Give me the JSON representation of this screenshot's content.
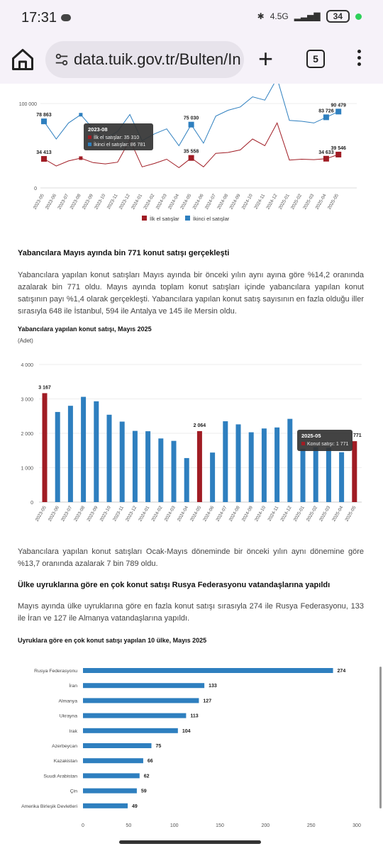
{
  "status_bar": {
    "time": "17:31",
    "network": "4.5G",
    "battery": "34"
  },
  "browser": {
    "url": "data.tuik.gov.tr/Bulten/In",
    "tab_count": "5"
  },
  "chart1": {
    "type": "line",
    "y_ticks": [
      "0",
      "100 000"
    ],
    "x_labels": [
      "2023-05",
      "2023-06",
      "2023-07",
      "2023-08",
      "2023-09",
      "2023-10",
      "2023-11",
      "2023-12",
      "2024-01",
      "2024-02",
      "2024-03",
      "2024-04",
      "2024-05",
      "2024-06",
      "2024-07",
      "2024-08",
      "2024-09",
      "2024-10",
      "2024-11",
      "2024-12",
      "2025-01",
      "2025-02",
      "2025-03",
      "2025-04",
      "2025-05"
    ],
    "series": [
      {
        "name": "İlk el satışlar",
        "color": "#a01c24",
        "values": [
          34413,
          26000,
          32000,
          35310,
          30000,
          28500,
          30500,
          57000,
          25000,
          29000,
          34000,
          24000,
          35558,
          25000,
          41000,
          42000,
          45000,
          58000,
          50000,
          77000,
          33000,
          34000,
          33500,
          34633,
          39546
        ]
      },
      {
        "name": "İkinci el satışlar",
        "color": "#2e7fbf",
        "values": [
          78863,
          58000,
          77000,
          86781,
          70000,
          58000,
          67000,
          87000,
          56000,
          64000,
          70000,
          50000,
          75030,
          53000,
          85000,
          92000,
          96000,
          108000,
          104000,
          130000,
          80000,
          79000,
          77000,
          83726,
          90479
        ]
      }
    ],
    "point_labels": [
      {
        "text": "78 863",
        "i": 0,
        "s": 1
      },
      {
        "text": "34 413",
        "i": 0,
        "s": 0
      },
      {
        "text": "75 030",
        "i": 12,
        "s": 1
      },
      {
        "text": "35 558",
        "i": 12,
        "s": 0
      },
      {
        "text": "83 726",
        "i": 23,
        "s": 1
      },
      {
        "text": "34 633",
        "i": 23,
        "s": 0
      },
      {
        "text": "90 479",
        "i": 24,
        "s": 1
      },
      {
        "text": "39 546",
        "i": 24,
        "s": 0
      }
    ],
    "tooltip": {
      "title": "2023-08",
      "line1": "İlk el satışlar: 35 310",
      "line2": "İkinci el satışlar: 86 781"
    },
    "legend": [
      "İlk el satışlar",
      "İkinci el satışlar"
    ]
  },
  "section1": {
    "heading": "Yabancılara Mayıs ayında bin 771 konut satışı gerçekleşti",
    "paragraph": "Yabancılara yapılan konut satışları Mayıs ayında bir önceki yılın aynı ayına göre %14,2 oranında azalarak bin 771 oldu. Mayıs ayında toplam konut satışları içinde yabancılara yapılan konut satışının payı %1,4 olarak gerçekleşti. Yabancılara yapılan konut satış sayısının en fazla olduğu iller sırasıyla 648 ile İstanbul, 594 ile Antalya ve 145 ile Mersin oldu."
  },
  "chart2": {
    "title": "Yabancılara yapılan konut satışı, Mayıs 2025",
    "unit": "(Adet)",
    "type": "bar",
    "y_ticks": [
      "0",
      "1 000",
      "2 000",
      "3 000",
      "4 000"
    ],
    "ylim": [
      0,
      4000
    ],
    "categories": [
      "2023-05",
      "2023-06",
      "2023-07",
      "2023-08",
      "2023-09",
      "2023-10",
      "2023-11",
      "2023-12",
      "2024-01",
      "2024-02",
      "2024-03",
      "2024-04",
      "2024-05",
      "2024-06",
      "2024-07",
      "2024-08",
      "2024-09",
      "2024-10",
      "2024-11",
      "2024-12",
      "2025-01",
      "2025-02",
      "2025-03",
      "2025-04",
      "2025-05"
    ],
    "values": [
      3167,
      2620,
      2800,
      3060,
      2930,
      2540,
      2340,
      2070,
      2060,
      1850,
      1780,
      1280,
      2064,
      1440,
      2350,
      2260,
      2030,
      2140,
      2170,
      2420,
      1550,
      1600,
      1580,
      1450,
      1771
    ],
    "highlight": [
      0,
      12,
      24
    ],
    "bar_labels": [
      {
        "i": 0,
        "text": "3 167"
      },
      {
        "i": 12,
        "text": "2 064"
      },
      {
        "i": 24,
        "text": "771"
      }
    ],
    "colors": {
      "normal": "#2e7fbf",
      "highlight": "#a01c24"
    },
    "tooltip": {
      "title": "2025-05",
      "line": "Konut satışı: 1 771"
    }
  },
  "section2": {
    "paragraph": "Yabancılara yapılan konut satışları Ocak-Mayıs döneminde bir önceki yılın aynı dönemine göre %13,7 oranında azalarak 7 bin 789 oldu.",
    "heading": "Ülke uyruklarına göre en çok konut satışı Rusya Federasyonu vatandaşlarına yapıldı",
    "paragraph2": "Mayıs ayında ülke uyruklarına göre en fazla konut satışı sırasıyla 274 ile Rusya Federasyonu, 133 ile İran ve 127 ile Almanya vatandaşlarına yapıldı."
  },
  "chart3": {
    "title": "Uyruklara göre en çok konut satışı yapılan 10 ülke, Mayıs 2025",
    "type": "bar",
    "orientation": "horizontal",
    "categories": [
      "Rusya Federasyonu",
      "İran",
      "Almanya",
      "Ukrayna",
      "Irak",
      "Azerbeycan",
      "Kazakistan",
      "Suudi Arabistan",
      "Çin",
      "Amerika Birleşik Devletleri"
    ],
    "values": [
      274,
      133,
      127,
      113,
      104,
      75,
      66,
      62,
      59,
      49
    ],
    "x_ticks": [
      "0",
      "50",
      "100",
      "150",
      "200",
      "250",
      "300"
    ],
    "xlim": [
      0,
      300
    ],
    "color": "#2e7fbf"
  }
}
